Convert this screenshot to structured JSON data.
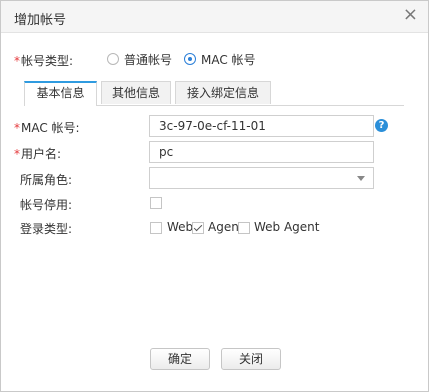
{
  "dialog": {
    "title": "增加帐号",
    "close_glyph": "×"
  },
  "account_type": {
    "label": "帐号类型:",
    "required_mark": "*",
    "options": [
      {
        "label": "普通帐号",
        "selected": false
      },
      {
        "label": "MAC 帐号",
        "selected": true
      }
    ]
  },
  "tabs": [
    {
      "label": "基本信息",
      "active": true
    },
    {
      "label": "其他信息",
      "active": false
    },
    {
      "label": "接入绑定信息",
      "active": false
    }
  ],
  "form": {
    "mac": {
      "label": "MAC 帐号:",
      "required": true,
      "value": "3c-97-0e-cf-11-01",
      "help_icon": "help-icon",
      "help_glyph": "?"
    },
    "username": {
      "label": "用户名:",
      "required": true,
      "value": "pc"
    },
    "role": {
      "label": "所属角色:",
      "value": "",
      "icon": "chevron-down-icon"
    },
    "disabled": {
      "label": "帐号停用:",
      "checked": false
    },
    "login_type": {
      "label": "登录类型:",
      "options": [
        {
          "label": "Web",
          "checked": false
        },
        {
          "label": "Agent",
          "checked": true
        },
        {
          "label": "Web Agent",
          "checked": false
        }
      ]
    }
  },
  "buttons": {
    "ok": "确定",
    "close": "关闭"
  },
  "colors": {
    "accent": "#2f9be0",
    "required": "#e4393c",
    "help": "#2b8fd9"
  }
}
